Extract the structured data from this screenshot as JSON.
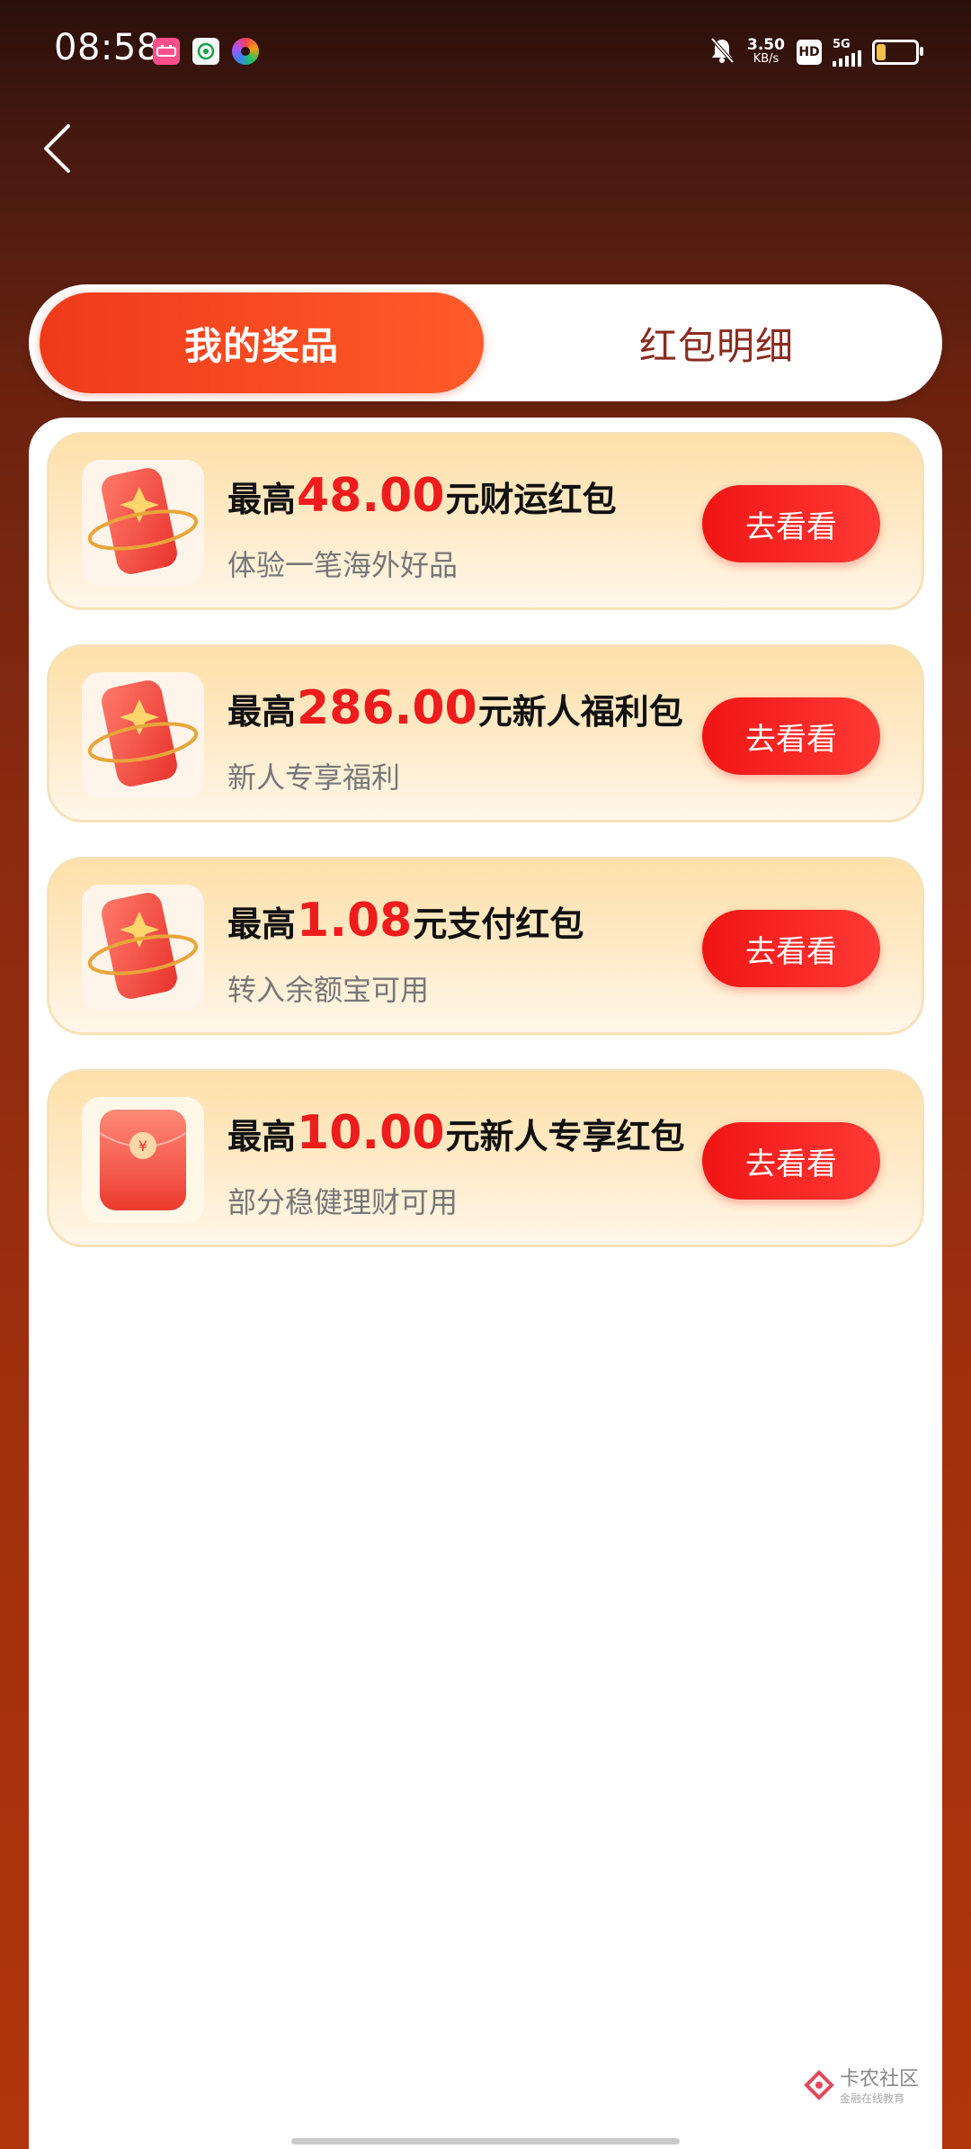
{
  "status_bar": {
    "time": "08:58",
    "speed_value": "3.50",
    "speed_unit": "KB/s",
    "hd_label": "HD",
    "network_label": "5G",
    "battery_color": "#f1c24a",
    "left_icons": [
      "pink-app-icon",
      "green-app-icon",
      "multicolor-app-icon"
    ],
    "right_icons": [
      "bell-muted-icon",
      "hd-badge",
      "signal-icon",
      "battery-icon"
    ]
  },
  "nav": {
    "back_icon": "chevron-left-icon"
  },
  "tabs": [
    {
      "label": "我的奖品",
      "active": true
    },
    {
      "label": "红包明细",
      "active": false
    }
  ],
  "prizes": [
    {
      "prefix": "最高",
      "amount": "48.00",
      "suffix": "元财运红包",
      "subtitle": "体验一笔海外好品",
      "button": "去看看",
      "icon": "red-envelope-star-icon"
    },
    {
      "prefix": "最高",
      "amount": "286.00",
      "suffix": "元新人福利包",
      "subtitle": "新人专享福利",
      "button": "去看看",
      "icon": "red-envelope-star-icon"
    },
    {
      "prefix": "最高",
      "amount": "1.08",
      "suffix": "元支付红包",
      "subtitle": "转入余额宝可用",
      "button": "去看看",
      "icon": "red-envelope-star-icon"
    },
    {
      "prefix": "最高",
      "amount": "10.00",
      "suffix": "元新人专享红包",
      "subtitle": "部分稳健理财可用",
      "button": "去看看",
      "icon": "red-envelope-yuan-icon"
    }
  ],
  "watermark": {
    "main": "卡农社区",
    "sub": "金融在线教育"
  },
  "colors": {
    "accent_red": "#ee1c1c",
    "tab_active": "#ef3a1a",
    "button_red": "#f01515",
    "card_bg": "#fde0a9"
  }
}
